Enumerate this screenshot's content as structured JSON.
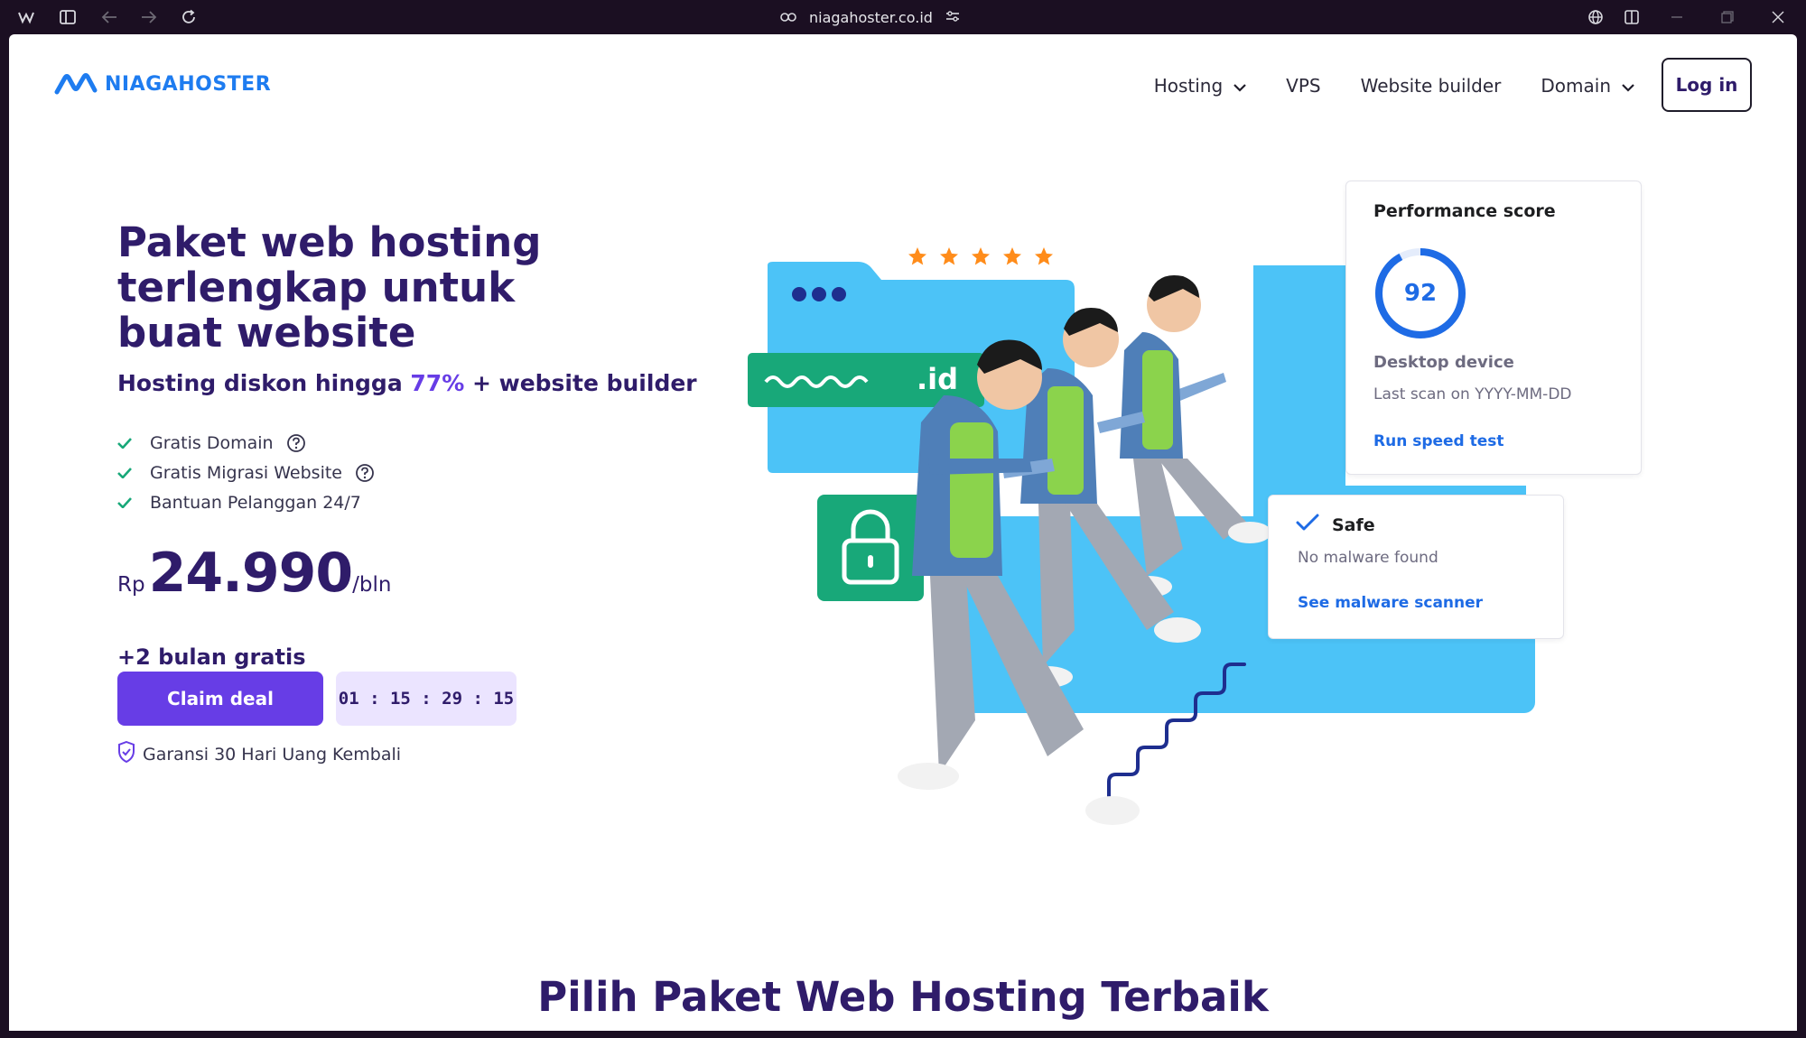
{
  "browser": {
    "url": "niagahoster.co.id"
  },
  "header": {
    "logo_text": "NIAGAHOSTER",
    "nav": [
      {
        "label": "Hosting",
        "has_dropdown": true
      },
      {
        "label": "VPS",
        "has_dropdown": false
      },
      {
        "label": "Website builder",
        "has_dropdown": false
      },
      {
        "label": "Domain",
        "has_dropdown": true
      }
    ],
    "login_label": "Log in"
  },
  "hero": {
    "title": "Paket web hosting terlengkap untuk buat website",
    "subtitle_prefix": "Hosting diskon hingga ",
    "subtitle_highlight": "77%",
    "subtitle_suffix": " + website builder",
    "features": [
      {
        "label": "Gratis Domain",
        "has_help": true
      },
      {
        "label": "Gratis Migrasi Website",
        "has_help": true
      },
      {
        "label": "Bantuan Pelanggan 24/7",
        "has_help": false
      }
    ],
    "price_currency": "Rp",
    "price_amount": "24.990",
    "price_period": "/bln",
    "bonus": "+2 bulan gratis",
    "claim_label": "Claim deal",
    "timer": "01 : 15 : 29 : 15",
    "guarantee": "Garansi 30 Hari Uang Kembali"
  },
  "illustration": {
    "domain_ext": ".id",
    "rating_stars": 5,
    "performance_card": {
      "title": "Performance score",
      "score": "92",
      "device": "Desktop device",
      "last_scan": "Last scan on YYYY-MM-DD",
      "link": "Run speed test"
    },
    "safe_card": {
      "title": "Safe",
      "subtitle": "No malware found",
      "link": "See malware scanner"
    }
  },
  "section": {
    "title": "Pilih Paket Web Hosting Terbaik"
  },
  "colors": {
    "primary": "#673de6",
    "brand_blue": "#1e7cf0",
    "text_dark": "#2f1c6a",
    "sky_blue": "#4cc3f7",
    "green": "#18a879",
    "star": "#ff8c1a"
  }
}
